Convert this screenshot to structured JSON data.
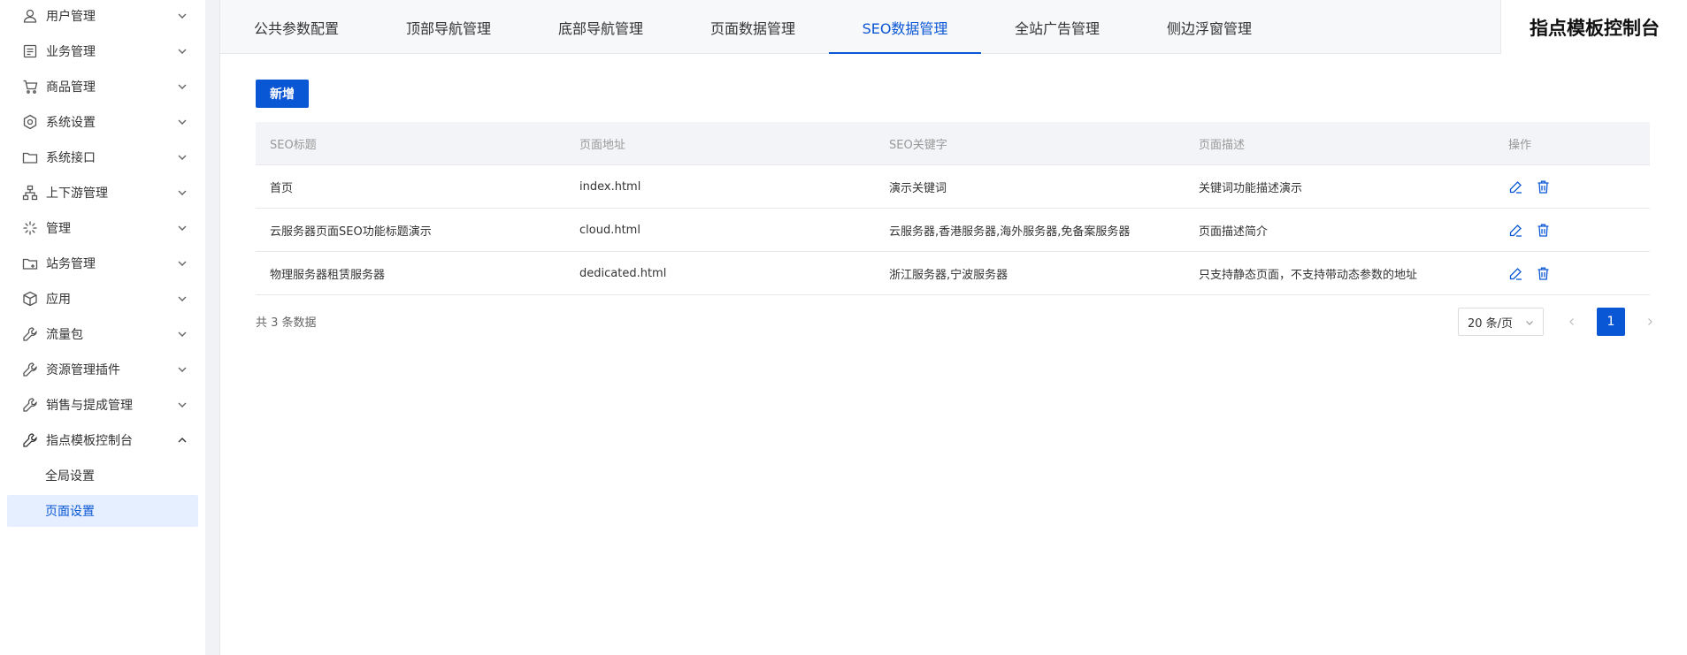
{
  "sidebar": {
    "items": [
      {
        "label": "用户管理",
        "icon": "user-icon"
      },
      {
        "label": "业务管理",
        "icon": "list-icon"
      },
      {
        "label": "商品管理",
        "icon": "cart-icon"
      },
      {
        "label": "系统设置",
        "icon": "settings-icon"
      },
      {
        "label": "系统接口",
        "icon": "folder-icon"
      },
      {
        "label": "上下游管理",
        "icon": "hierarchy-icon"
      },
      {
        "label": "管理",
        "icon": "sparkle-icon"
      },
      {
        "label": "站务管理",
        "icon": "folder-add-icon"
      },
      {
        "label": "应用",
        "icon": "cube-icon"
      },
      {
        "label": "流量包",
        "icon": "wrench-icon"
      },
      {
        "label": "资源管理插件",
        "icon": "wrench-icon"
      },
      {
        "label": "销售与提成管理",
        "icon": "wrench-icon"
      },
      {
        "label": "指点模板控制台",
        "icon": "wrench-icon"
      }
    ],
    "subitems": [
      {
        "label": "全局设置"
      },
      {
        "label": "页面设置",
        "active": true
      }
    ]
  },
  "tabs": [
    {
      "label": "公共参数配置"
    },
    {
      "label": "顶部导航管理"
    },
    {
      "label": "底部导航管理"
    },
    {
      "label": "页面数据管理"
    },
    {
      "label": "SEO数据管理",
      "active": true
    },
    {
      "label": "全站广告管理"
    },
    {
      "label": "侧边浮窗管理"
    }
  ],
  "brand": "指点模板控制台",
  "toolbar": {
    "add_label": "新增"
  },
  "table": {
    "headers": [
      "SEO标题",
      "页面地址",
      "SEO关键字",
      "页面描述",
      "操作"
    ],
    "rows": [
      [
        "首页",
        "index.html",
        "演示关键词",
        "关键词功能描述演示"
      ],
      [
        "云服务器页面SEO功能标题演示",
        "cloud.html",
        "云服务器,香港服务器,海外服务器,免备案服务器",
        "页面描述简介"
      ],
      [
        "物理服务器租赁服务器",
        "dedicated.html",
        "浙江服务器,宁波服务器",
        "只支持静态页面，不支持带动态参数的地址"
      ]
    ]
  },
  "pagination": {
    "total_text": "共 3 条数据",
    "page_size": "20 条/页",
    "current_page": "1"
  },
  "colors": {
    "accent": "#0a57d5",
    "active_bg": "#e6efff"
  }
}
